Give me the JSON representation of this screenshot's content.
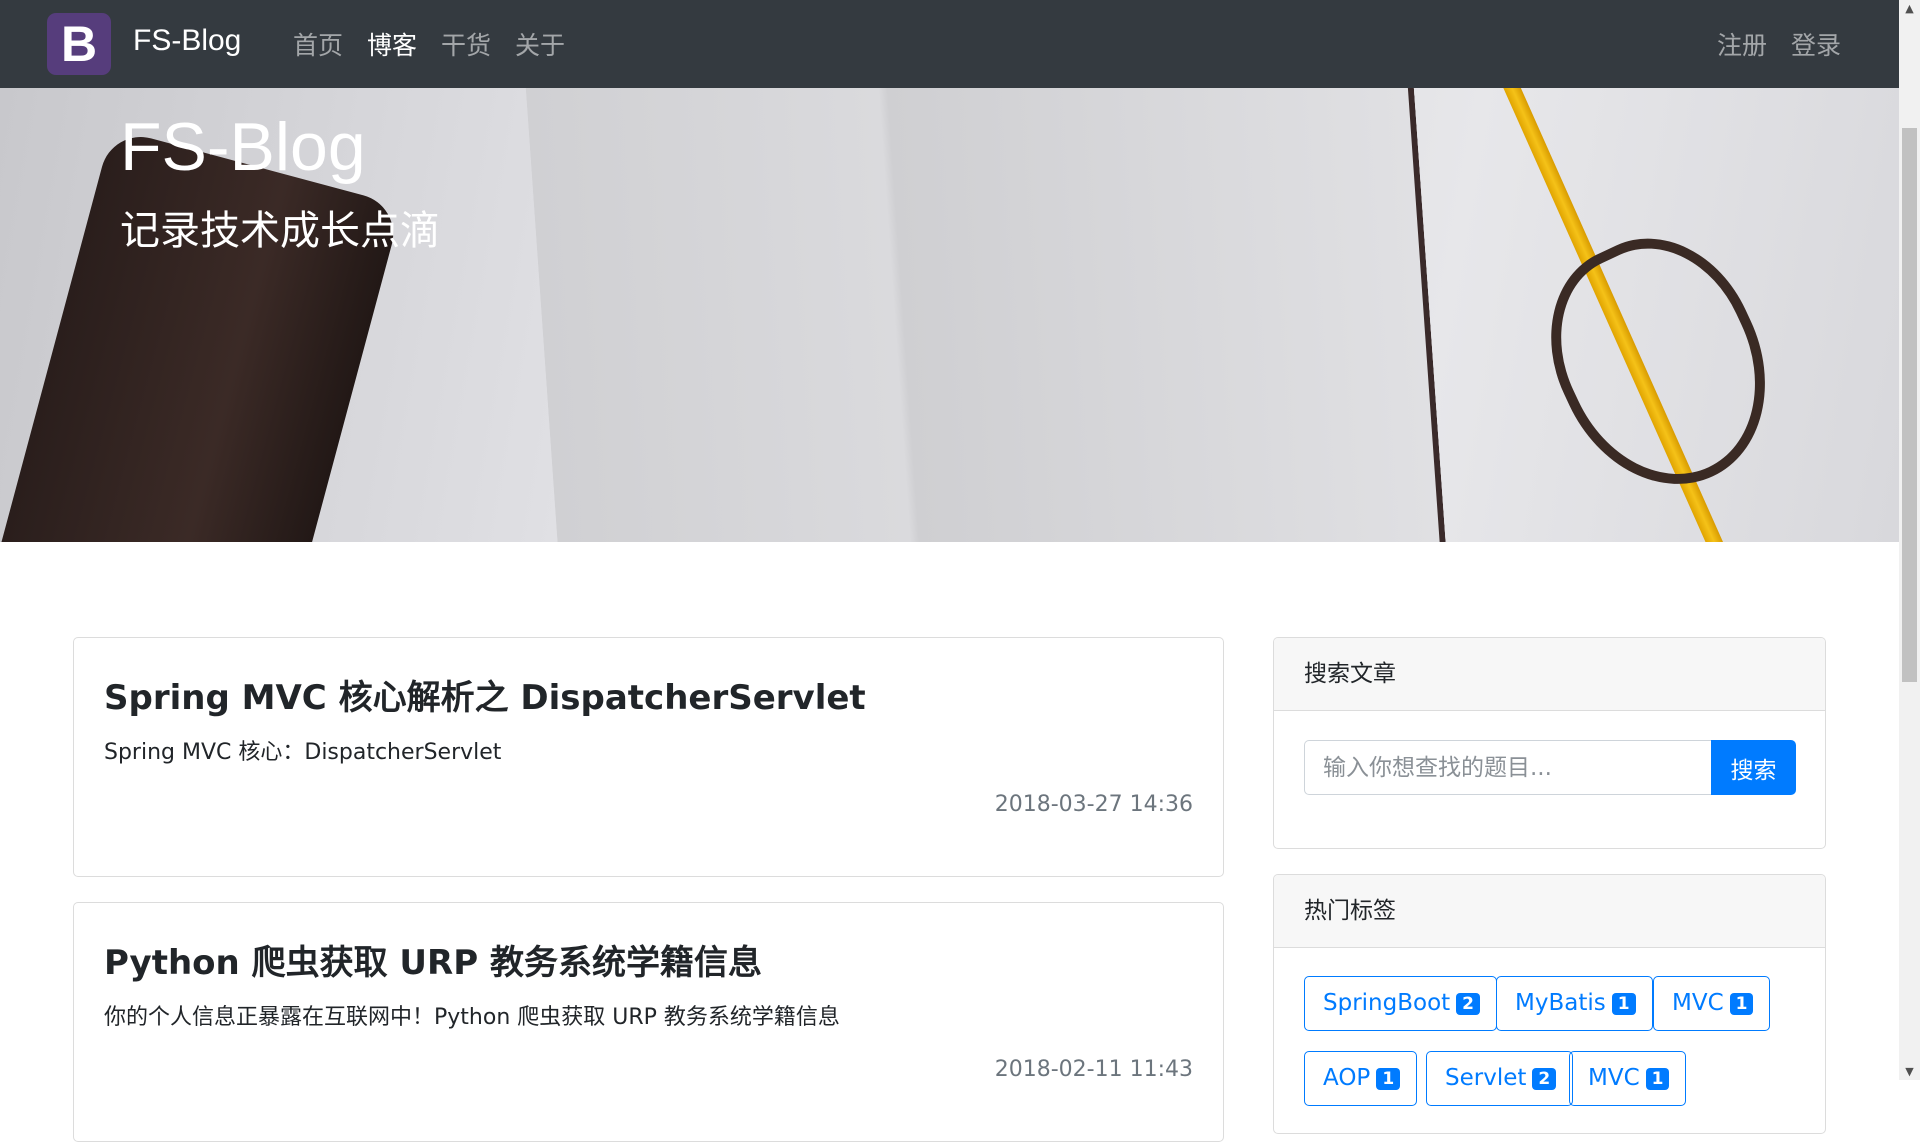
{
  "navbar": {
    "logo_letter": "B",
    "brand": "FS-Blog",
    "links": [
      "首页",
      "博客",
      "干货",
      "关于"
    ],
    "active_link": "博客",
    "right_links": [
      "注册",
      "登录"
    ],
    "background": "#343a40",
    "logo_color": "#563d7c"
  },
  "hero": {
    "title": "FS-Blog",
    "subtitle": "记录技术成长点滴"
  },
  "posts": [
    {
      "title": "Spring MVC 核心解析之 DispatcherServlet",
      "summary": "Spring MVC 核心：DispatcherServlet",
      "date": "2018-03-27 14:36"
    },
    {
      "title": "Python 爬虫获取 URP 教务系统学籍信息",
      "summary": "你的个人信息正暴露在互联网中！Python 爬虫获取 URP 教务系统学籍信息",
      "date": "2018-02-11 11:43"
    }
  ],
  "search_card": {
    "header": "搜索文章",
    "placeholder": "输入你想查找的题目...",
    "button": "搜索",
    "button_color": "#007bff"
  },
  "tags_card": {
    "header": "热门标签",
    "tags": [
      {
        "name": "SpringBoot",
        "count": "2"
      },
      {
        "name": "MyBatis",
        "count": "1"
      },
      {
        "name": "MVC",
        "count": "1"
      },
      {
        "name": "AOP",
        "count": "1"
      },
      {
        "name": "Servlet",
        "count": "2"
      },
      {
        "name": "MVC",
        "count": "1"
      }
    ]
  }
}
